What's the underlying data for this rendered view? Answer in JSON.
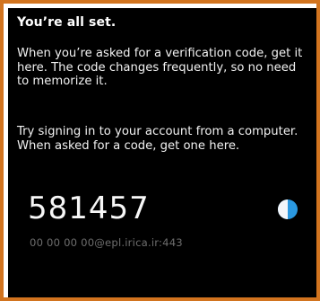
{
  "screen": {
    "title": "You’re all set.",
    "paragraph1": "When you’re asked for a verification code, get it here. The code changes frequently, so no need to memorize it.",
    "paragraph2": "Try signing in to your account from a computer. When asked for a code, get one here."
  },
  "account_entry": {
    "code": "581457",
    "account_name": "00 00 00 00@epl.irica.ir:443",
    "timer_icon": "countdown-pie-icon",
    "timer_remaining_fraction": 0.5
  },
  "colors": {
    "frame_border": "#d2741f",
    "background": "#000000",
    "timer_accent": "#2a98e0"
  }
}
